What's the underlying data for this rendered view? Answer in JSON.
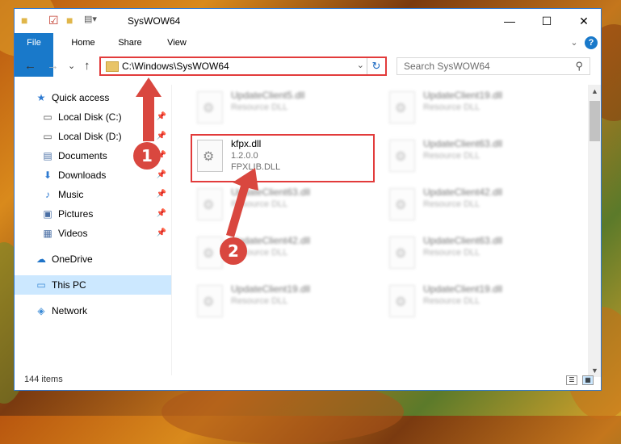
{
  "window": {
    "title": "SysWOW64",
    "minimize_glyph": "—",
    "maximize_glyph": "☐",
    "close_glyph": "✕"
  },
  "ribbon": {
    "tabs": [
      "File",
      "Home",
      "Share",
      "View"
    ],
    "expand_glyph": "⌄",
    "help_glyph": "?"
  },
  "nav_buttons": {
    "back": "←",
    "forward": "→",
    "recent": "⌄",
    "up": "↑"
  },
  "address": {
    "path": "C:\\Windows\\SysWOW64",
    "dropdown_glyph": "⌄",
    "refresh_glyph": "↻"
  },
  "search": {
    "placeholder": "Search SysWOW64",
    "icon_glyph": "⚲"
  },
  "sidebar": [
    {
      "label": "Quick access",
      "icon": "star-icon",
      "glyph": "★",
      "color": "#2e7ad1",
      "pinned": false
    },
    {
      "label": "Local Disk (C:)",
      "icon": "drive-icon",
      "glyph": "▭",
      "color": "#555555",
      "pinned": true
    },
    {
      "label": "Local Disk (D:)",
      "icon": "drive-icon",
      "glyph": "▭",
      "color": "#555555",
      "pinned": true
    },
    {
      "label": "Documents",
      "icon": "documents-icon",
      "glyph": "▤",
      "color": "#4a6fa5",
      "pinned": true
    },
    {
      "label": "Downloads",
      "icon": "downloads-icon",
      "glyph": "⬇",
      "color": "#2e7ad1",
      "pinned": true
    },
    {
      "label": "Music",
      "icon": "music-icon",
      "glyph": "♪",
      "color": "#2e7ad1",
      "pinned": true
    },
    {
      "label": "Pictures",
      "icon": "pictures-icon",
      "glyph": "▣",
      "color": "#4a6fa5",
      "pinned": true
    },
    {
      "label": "Videos",
      "icon": "videos-icon",
      "glyph": "▦",
      "color": "#4a6fa5",
      "pinned": true
    },
    {
      "label": "OneDrive",
      "icon": "onedrive-icon",
      "glyph": "☁",
      "color": "#1e73c8",
      "pinned": false
    },
    {
      "label": "This PC",
      "icon": "pc-icon",
      "glyph": "▭",
      "color": "#3a8ad6",
      "pinned": false
    },
    {
      "label": "Network",
      "icon": "network-icon",
      "glyph": "◈",
      "color": "#3a8ad6",
      "pinned": false
    }
  ],
  "pin_glyph": "📌",
  "files": [
    {
      "name": "UpdateClient5.dll",
      "line2": "Resource DLL",
      "line3": "",
      "blurred": true
    },
    {
      "name": "UpdateClient19.dll",
      "line2": "Resource DLL",
      "line3": "",
      "blurred": true
    },
    {
      "name": "kfpx.dll",
      "line2": "1.2.0.0",
      "line3": "FPXLIB.DLL",
      "blurred": false
    },
    {
      "name": "UpdateClient63.dll",
      "line2": "Resource DLL",
      "line3": "",
      "blurred": true
    },
    {
      "name": "UpdateClient63.dll",
      "line2": "Resource DLL",
      "line3": "",
      "blurred": true
    },
    {
      "name": "UpdateClient42.dll",
      "line2": "Resource DLL",
      "line3": "",
      "blurred": true
    },
    {
      "name": "UpdateClient42.dll",
      "line2": "Resource DLL",
      "line3": "",
      "blurred": true
    },
    {
      "name": "UpdateClient63.dll",
      "line2": "Resource DLL",
      "line3": "",
      "blurred": true
    },
    {
      "name": "UpdateClient19.dll",
      "line2": "Resource DLL",
      "line3": "",
      "blurred": true
    },
    {
      "name": "UpdateClient19.dll",
      "line2": "Resource DLL",
      "line3": "",
      "blurred": true
    }
  ],
  "status": {
    "item_count": "144 items"
  },
  "callouts": [
    "1",
    "2"
  ],
  "colors": {
    "accent": "#1979ca",
    "highlight": "#e23b3b",
    "callout": "#d9473f"
  }
}
